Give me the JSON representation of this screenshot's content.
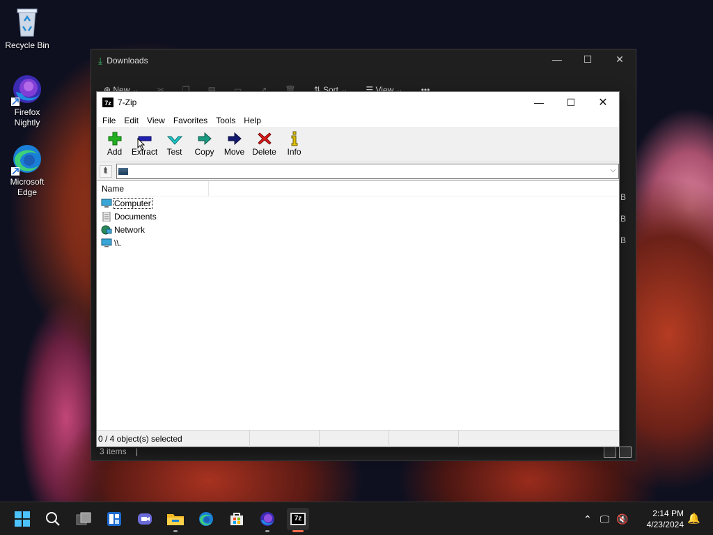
{
  "desktop": {
    "icons": [
      {
        "label": "Recycle Bin",
        "icon": "recycle-bin-icon"
      },
      {
        "label": "Firefox Nightly",
        "icon": "firefox-nightly-icon"
      },
      {
        "label": "Microsoft Edge",
        "icon": "edge-icon"
      }
    ]
  },
  "explorer": {
    "title": "Downloads",
    "cmd": {
      "new": "New",
      "sort": "Sort",
      "view": "View",
      "more": "•••"
    },
    "status": "3 items",
    "size_fragments": [
      "B",
      "B",
      "B"
    ]
  },
  "sevenzip": {
    "title": "7-Zip",
    "badge": "7z",
    "menu": [
      "File",
      "Edit",
      "View",
      "Favorites",
      "Tools",
      "Help"
    ],
    "toolbar": [
      "Add",
      "Extract",
      "Test",
      "Copy",
      "Move",
      "Delete",
      "Info"
    ],
    "address": "",
    "columns": [
      "Name"
    ],
    "rows": [
      {
        "name": "Computer",
        "icon": "computer-icon"
      },
      {
        "name": "Documents",
        "icon": "documents-icon"
      },
      {
        "name": "Network",
        "icon": "network-icon"
      },
      {
        "name": "\\\\.",
        "icon": "drive-root-icon"
      }
    ],
    "status": {
      "selected": "0 / 4 object(s) selected",
      "c2": "",
      "c3": "",
      "c4": ""
    }
  },
  "taskbar": {
    "apps": [
      "start-icon",
      "search-icon",
      "task-view-icon",
      "widgets-icon",
      "chat-icon",
      "file-explorer-icon",
      "edge-icon",
      "store-icon",
      "firefox-nightly-icon",
      "sevenzip-icon"
    ],
    "time": "2:14 PM",
    "date": "4/23/2024"
  },
  "colors": {
    "accent": "#0078d4",
    "taskbar": "#1c1c1c"
  }
}
